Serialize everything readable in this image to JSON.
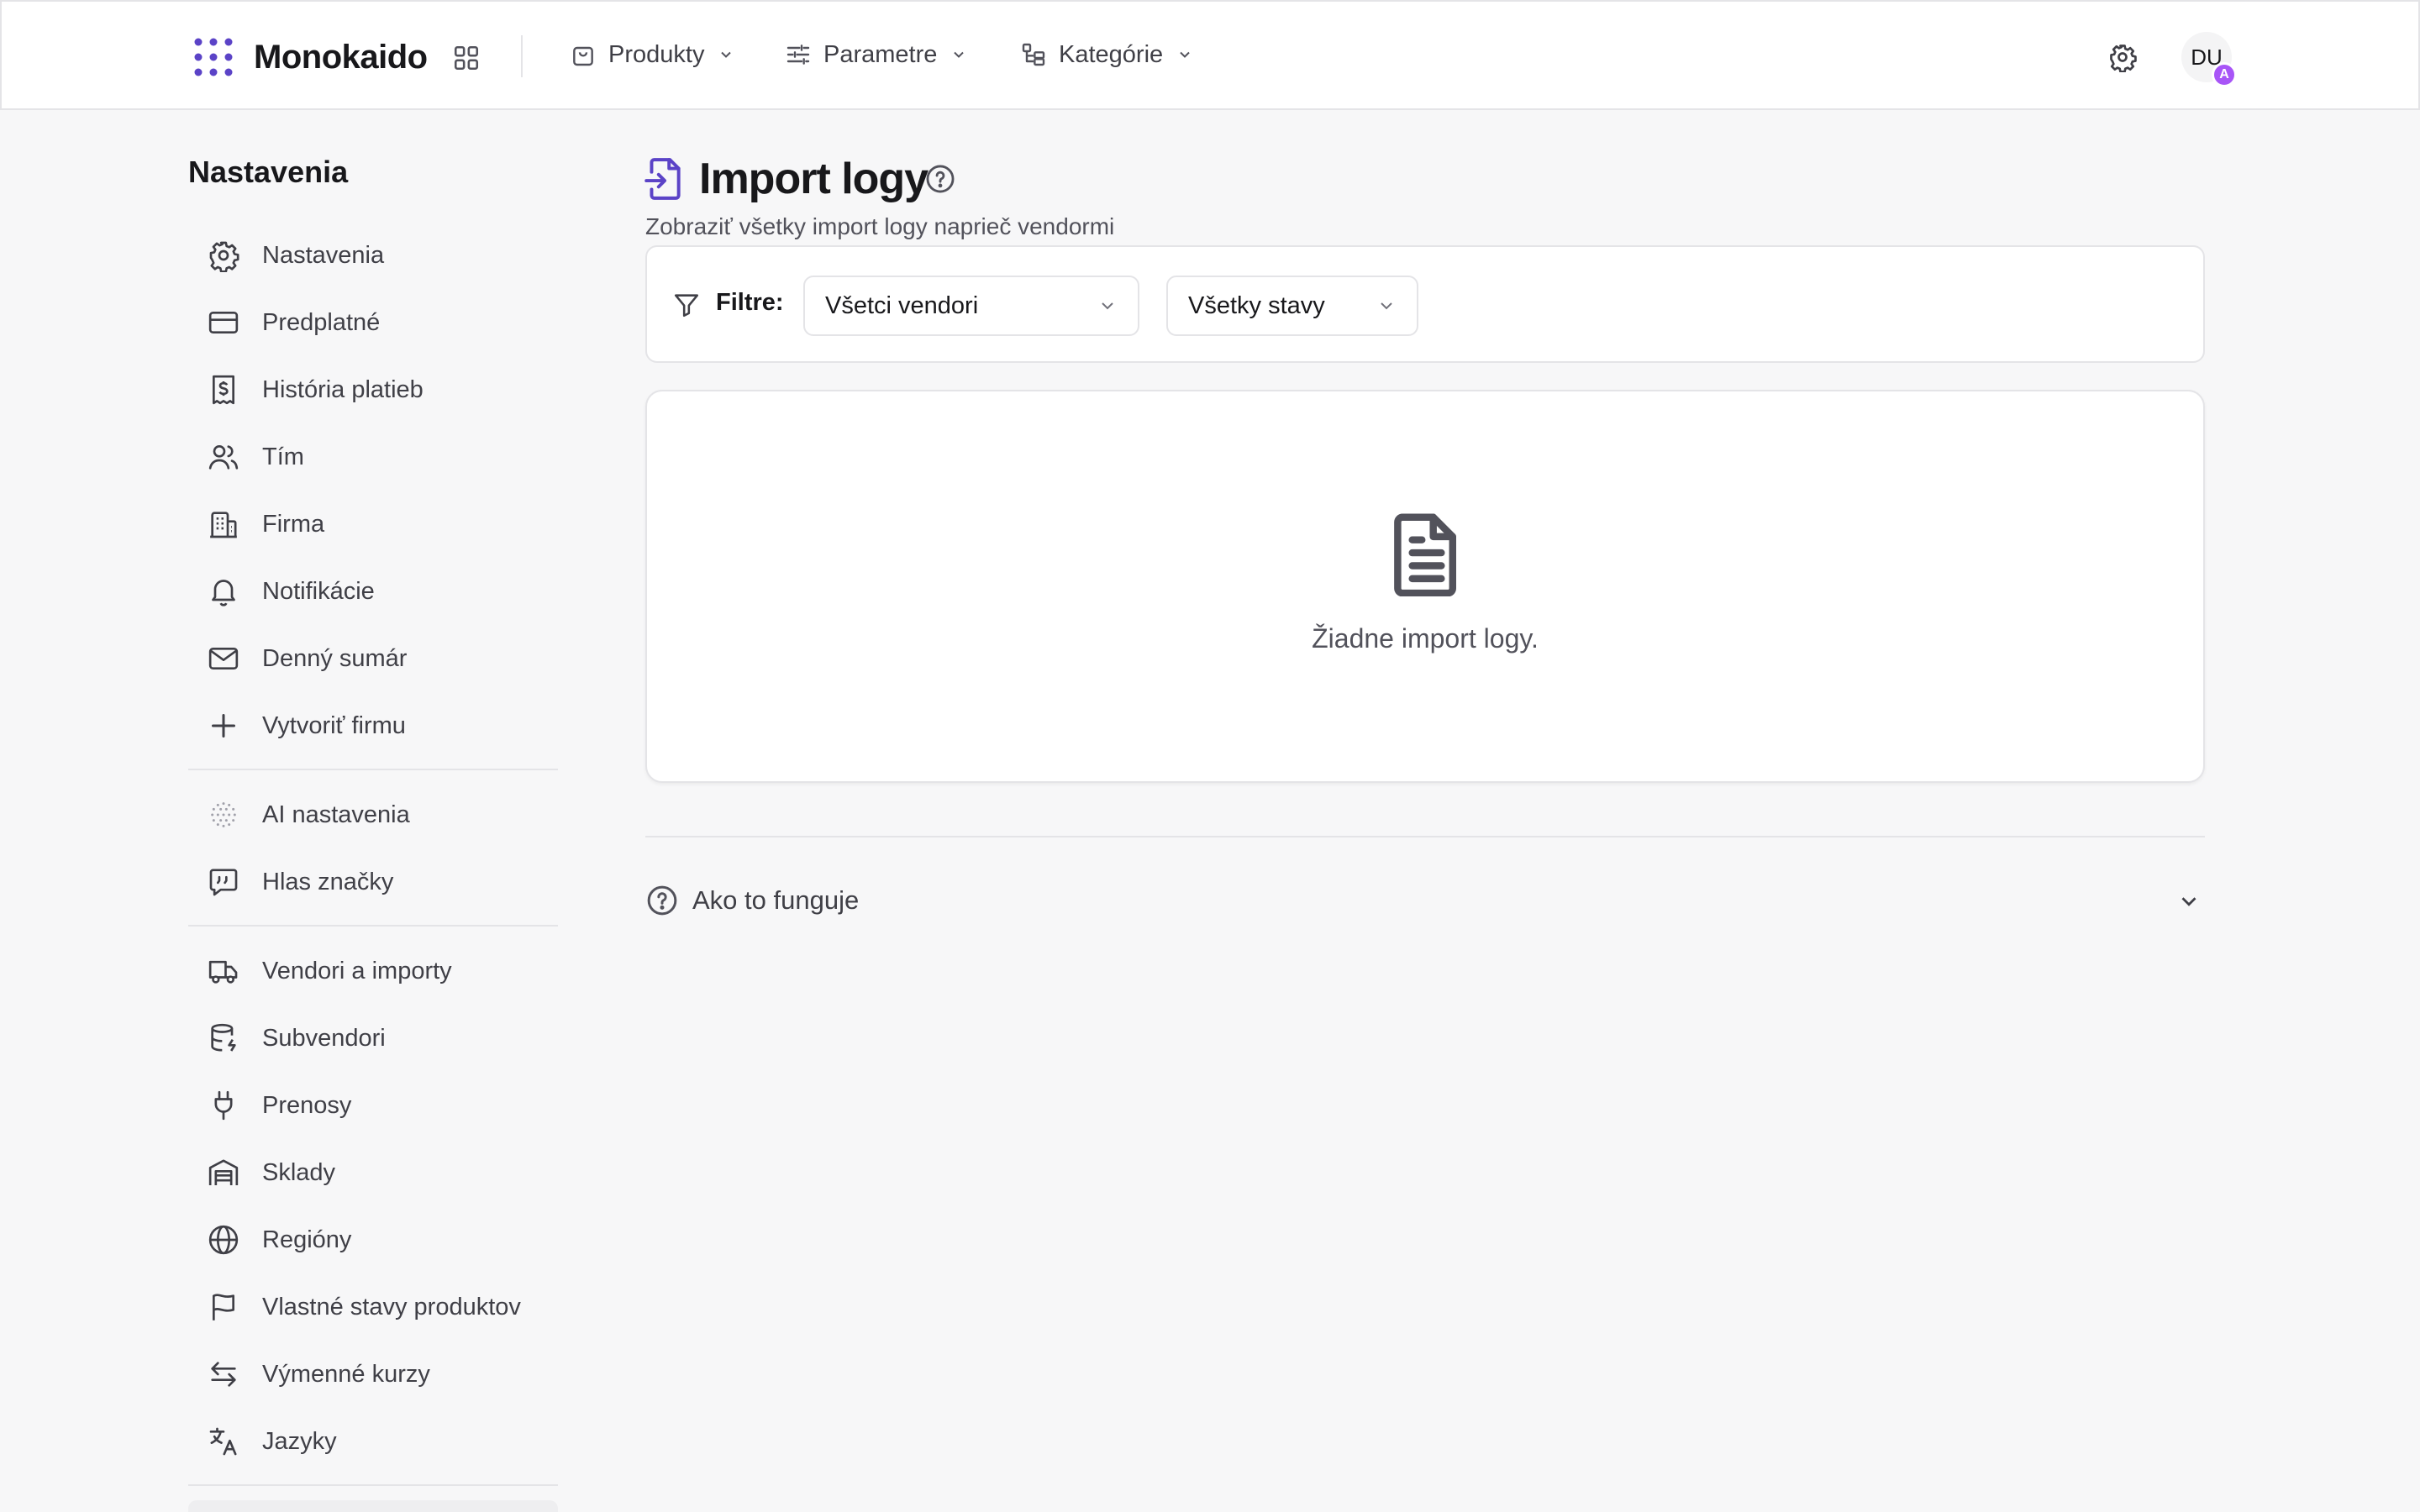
{
  "brand": {
    "name": "Monokaido",
    "accent": "#5b43c7"
  },
  "nav": {
    "items": [
      {
        "label": "Produkty",
        "icon": "shopping-bag-icon"
      },
      {
        "label": "Parametre",
        "icon": "sliders-icon"
      },
      {
        "label": "Kategórie",
        "icon": "category-tree-icon"
      }
    ]
  },
  "user": {
    "initials": "DU",
    "badge": "A",
    "badge_color": "#a855f7"
  },
  "sidebar": {
    "title": "Nastavenia",
    "items": [
      {
        "label": "Nastavenia",
        "icon": "gear-icon"
      },
      {
        "label": "Predplatné",
        "icon": "credit-card-icon"
      },
      {
        "label": "História platieb",
        "icon": "receipt-icon"
      },
      {
        "label": "Tím",
        "icon": "users-icon"
      },
      {
        "label": "Firma",
        "icon": "building-icon"
      },
      {
        "label": "Notifikácie",
        "icon": "bell-icon"
      },
      {
        "label": "Denný sumár",
        "icon": "mail-icon"
      },
      {
        "label": "Vytvoriť firmu",
        "icon": "plus-icon"
      },
      {
        "label": "AI nastavenia",
        "icon": "ai-sparkle-icon"
      },
      {
        "label": "Hlas značky",
        "icon": "quote-message-icon"
      },
      {
        "label": "Vendori a importy",
        "icon": "truck-icon"
      },
      {
        "label": "Subvendori",
        "icon": "database-icon"
      },
      {
        "label": "Prenosy",
        "icon": "plug-icon"
      },
      {
        "label": "Sklady",
        "icon": "warehouse-icon"
      },
      {
        "label": "Regióny",
        "icon": "globe-icon"
      },
      {
        "label": "Vlastné stavy produktov",
        "icon": "flag-icon"
      },
      {
        "label": "Výmenné kurzy",
        "icon": "exchange-arrows-icon"
      },
      {
        "label": "Jazyky",
        "icon": "translate-icon"
      }
    ]
  },
  "page": {
    "title": "Import logy",
    "subtitle": "Zobraziť všetky import logy naprieč vendormi"
  },
  "filters": {
    "label": "Filtre:",
    "vendor_select": "Všetci vendori",
    "status_select": "Všetky stavy"
  },
  "empty_state": {
    "message": "Žiadne import logy."
  },
  "how_it_works": {
    "label": "Ako to funguje"
  }
}
